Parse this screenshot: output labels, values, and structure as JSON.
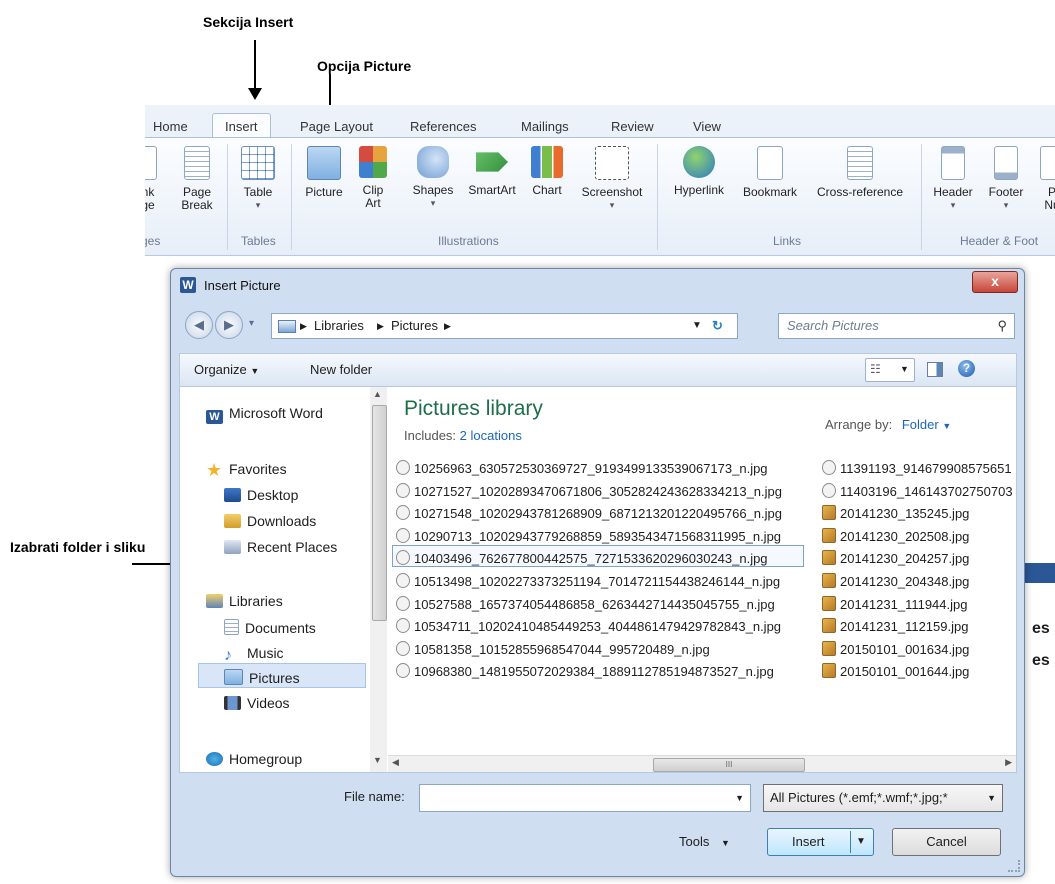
{
  "annotations": {
    "insert_tab_note": "Sekcija Insert",
    "picture_option_note": "Opcija Picture",
    "folder_note": "Izabrati folder i sliku"
  },
  "ribbon": {
    "tabs": [
      "Home",
      "Insert",
      "Page Layout",
      "References",
      "Mailings",
      "Review",
      "View"
    ],
    "active_tab": "Insert",
    "partial_left": {
      "line1": "nk",
      "line2": "ge",
      "line3": "ges"
    },
    "buttons": {
      "page_break": {
        "line1": "Page",
        "line2": "Break"
      },
      "table": "Table",
      "picture": "Picture",
      "clip_art": {
        "line1": "Clip",
        "line2": "Art"
      },
      "shapes": "Shapes",
      "smartart": "SmartArt",
      "chart": "Chart",
      "screenshot": "Screenshot",
      "hyperlink": "Hyperlink",
      "bookmark": "Bookmark",
      "cross_reference": "Cross-reference",
      "header": "Header",
      "footer": "Footer",
      "page_number_partial": {
        "line1": "P",
        "line2": "Nu"
      }
    },
    "groups": {
      "tables": "Tables",
      "illustrations": "Illustrations",
      "links": "Links",
      "header_footer": "Header & Foot"
    }
  },
  "dialog": {
    "title": "Insert Picture",
    "close_glyph": "x",
    "address": {
      "crumb1": "Libraries",
      "crumb2": "Pictures"
    },
    "search_placeholder": "Search Pictures",
    "toolbar": {
      "organize": "Organize",
      "new_folder": "New folder"
    },
    "nav": {
      "microsoft_word": "Microsoft Word",
      "favorites": "Favorites",
      "desktop": "Desktop",
      "downloads": "Downloads",
      "recent_places": "Recent Places",
      "libraries": "Libraries",
      "documents": "Documents",
      "music": "Music",
      "pictures": "Pictures",
      "videos": "Videos",
      "homegroup": "Homegroup"
    },
    "library": {
      "title": "Pictures library",
      "includes_label": "Includes:",
      "includes_link": "2 locations",
      "arrange_label": "Arrange by:",
      "arrange_value": "Folder"
    },
    "files_left": [
      "10256963_630572530369727_9193499133539067173_n.jpg",
      "10271527_10202893470671806_3052824243628334213_n.jpg",
      "10271548_10202943781268909_6871213201220495766_n.jpg",
      "10290713_10202943779268859_5893543471568311995_n.jpg",
      "10403496_762677800442575_7271533620296030243_n.jpg",
      "10513498_10202273373251194_7014721154438246144_n.jpg",
      "10527588_1657374054486858_6263442714435045755_n.jpg",
      "10534711_10202410485449253_4044861479429782843_n.jpg",
      "10581358_10152855968547044_995720489_n.jpg",
      "10968380_1481955072029384_1889112785194873527_n.jpg"
    ],
    "files_right": [
      "11391193_914679908575651",
      "11403196_146143702750703",
      "20141230_135245.jpg",
      "20141230_202508.jpg",
      "20141230_204257.jpg",
      "20141230_204348.jpg",
      "20141231_111944.jpg",
      "20141231_112159.jpg",
      "20150101_001634.jpg",
      "20150101_001644.jpg"
    ],
    "scroll_thumb": "III",
    "file_name_label": "File name:",
    "file_name_value": "",
    "filter": "All Pictures (*.emf;*.wmf;*.jpg;*",
    "tools": "Tools",
    "insert": "Insert",
    "cancel": "Cancel"
  },
  "background_doc": {
    "frag1": "es",
    "frag2": "es"
  }
}
